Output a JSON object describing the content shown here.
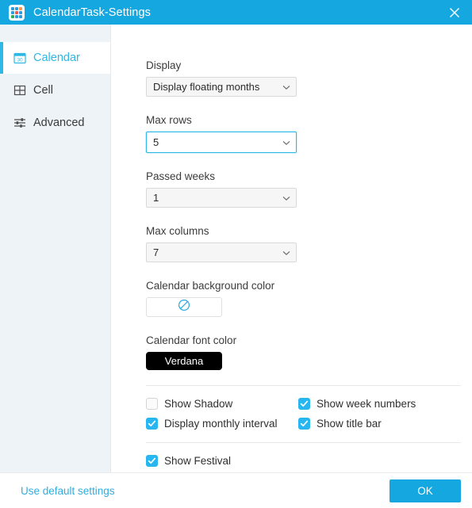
{
  "window": {
    "title": "CalendarTask-Settings",
    "icon": "calendar-grid-icon",
    "close_label": "×",
    "accent_color": "#14a7e0"
  },
  "sidebar": {
    "items": [
      {
        "label": "Calendar",
        "icon": "calendar-icon",
        "selected": true
      },
      {
        "label": "Cell",
        "icon": "grid-icon",
        "selected": false
      },
      {
        "label": "Advanced",
        "icon": "sliders-icon",
        "selected": false
      }
    ]
  },
  "main": {
    "fields": [
      {
        "label": "Display",
        "value": "Display floating months",
        "focused": false
      },
      {
        "label": "Max rows",
        "value": "5",
        "focused": true
      },
      {
        "label": "Passed weeks",
        "value": "1",
        "focused": false
      },
      {
        "label": "Max columns",
        "value": "7",
        "focused": false
      }
    ],
    "background_color": {
      "label": "Calendar background color",
      "value": "none",
      "icon": "no-color-icon",
      "icon_color": "#29a8e0"
    },
    "font_color": {
      "label": "Calendar font color",
      "value": "Verdana",
      "swatch_color": "#000000",
      "text_color": "#ffffff"
    },
    "checkboxes": [
      {
        "label": "Show Shadow",
        "checked": false
      },
      {
        "label": "Show week numbers",
        "checked": true
      },
      {
        "label": "Display monthly interval",
        "checked": true
      },
      {
        "label": "Show title bar",
        "checked": true
      }
    ],
    "festival": {
      "label": "Show Festival",
      "checked": true
    }
  },
  "footer": {
    "default_link": "Use default settings",
    "ok_label": "OK"
  }
}
